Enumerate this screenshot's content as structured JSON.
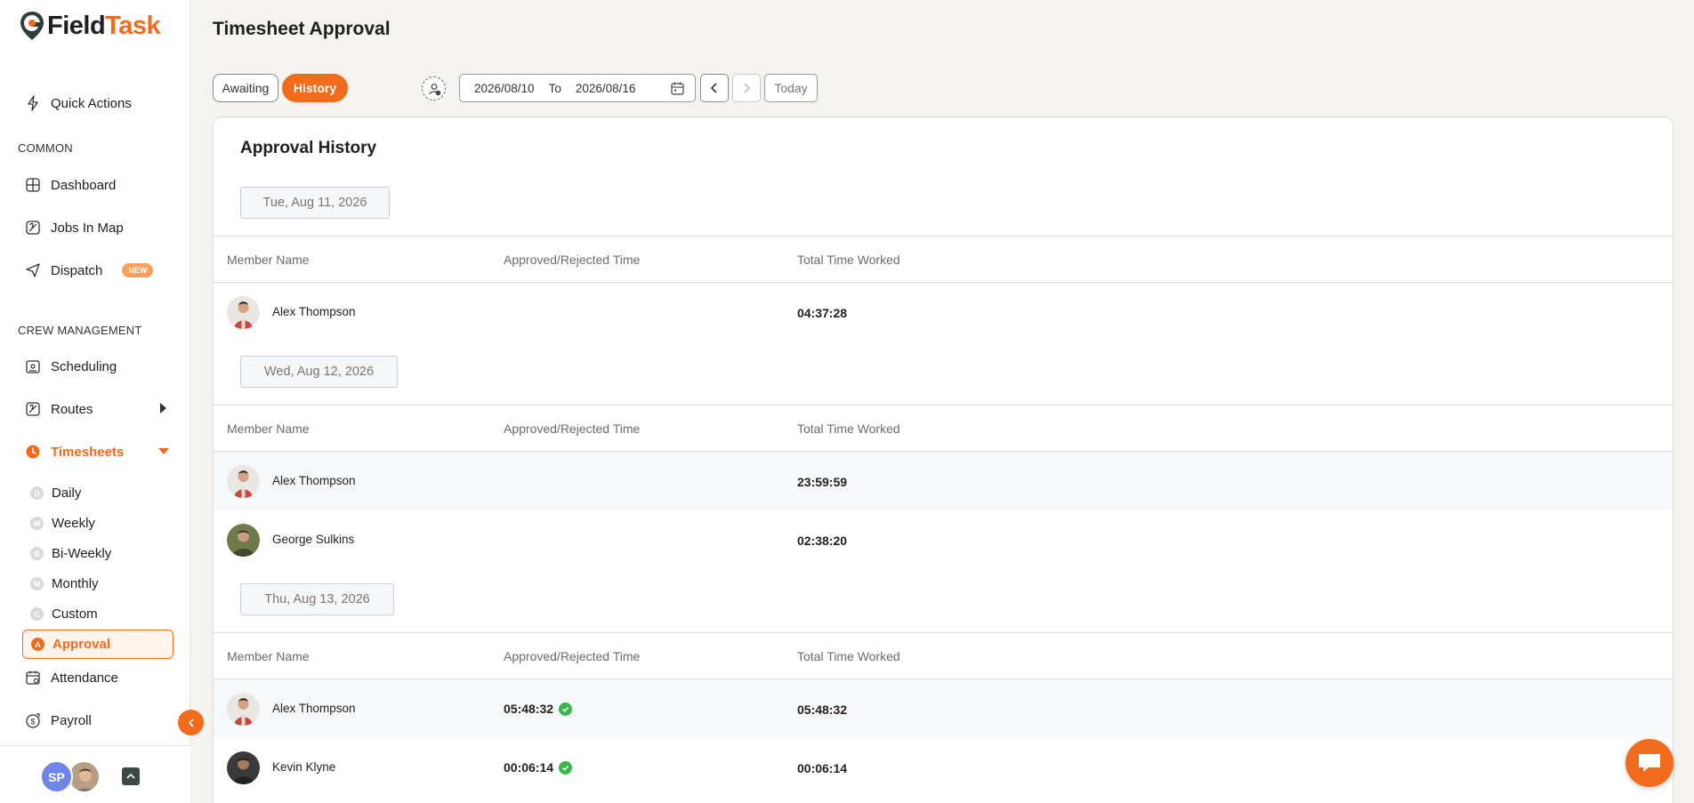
{
  "app": {
    "brand_field": "Field",
    "brand_task": "Task"
  },
  "sidebar": {
    "quick_actions": "Quick Actions",
    "section_common": "COMMON",
    "dashboard": "Dashboard",
    "jobs_in_map": "Jobs In Map",
    "dispatch": "Dispatch",
    "dispatch_badge": "NEW",
    "section_crew": "CREW MANAGEMENT",
    "scheduling": "Scheduling",
    "routes": "Routes",
    "timesheets": "Timesheets",
    "sub_items": [
      {
        "letter": "D",
        "label": "Daily"
      },
      {
        "letter": "W",
        "label": "Weekly"
      },
      {
        "letter": "B",
        "label": "Bi-Weekly"
      },
      {
        "letter": "M",
        "label": "Monthly"
      },
      {
        "letter": "C",
        "label": "Custom"
      },
      {
        "letter": "A",
        "label": "Approval"
      }
    ],
    "attendance": "Attendance",
    "payroll": "Payroll",
    "user_initials": "SP"
  },
  "header": {
    "title": "Timesheet Approval"
  },
  "toolbar": {
    "tab_awaiting": "Awaiting",
    "tab_history": "History",
    "date_from": "2026/08/10",
    "date_to_label": "To",
    "date_to": "2026/08/16",
    "today": "Today"
  },
  "history": {
    "title": "Approval History",
    "columns": {
      "member": "Member Name",
      "approved": "Approved/Rejected Time",
      "total": "Total Time Worked"
    },
    "groups": [
      {
        "date": "Tue, Aug 11, 2026",
        "rows": [
          {
            "name": "Alex Thompson",
            "approved": "",
            "total": "04:37:28"
          }
        ]
      },
      {
        "date": "Wed, Aug 12, 2026",
        "rows": [
          {
            "name": "Alex Thompson",
            "approved": "",
            "total": "23:59:59"
          },
          {
            "name": "George Sulkins",
            "approved": "",
            "total": "02:38:20"
          }
        ]
      },
      {
        "date": "Thu, Aug 13, 2026",
        "rows": [
          {
            "name": "Alex Thompson",
            "approved": "05:48:32",
            "total": "05:48:32"
          },
          {
            "name": "Kevin Klyne",
            "approved": "00:06:14",
            "total": "00:06:14"
          }
        ]
      }
    ]
  },
  "colors": {
    "accent": "#f26a1b",
    "approved_check": "#3bb54a"
  }
}
